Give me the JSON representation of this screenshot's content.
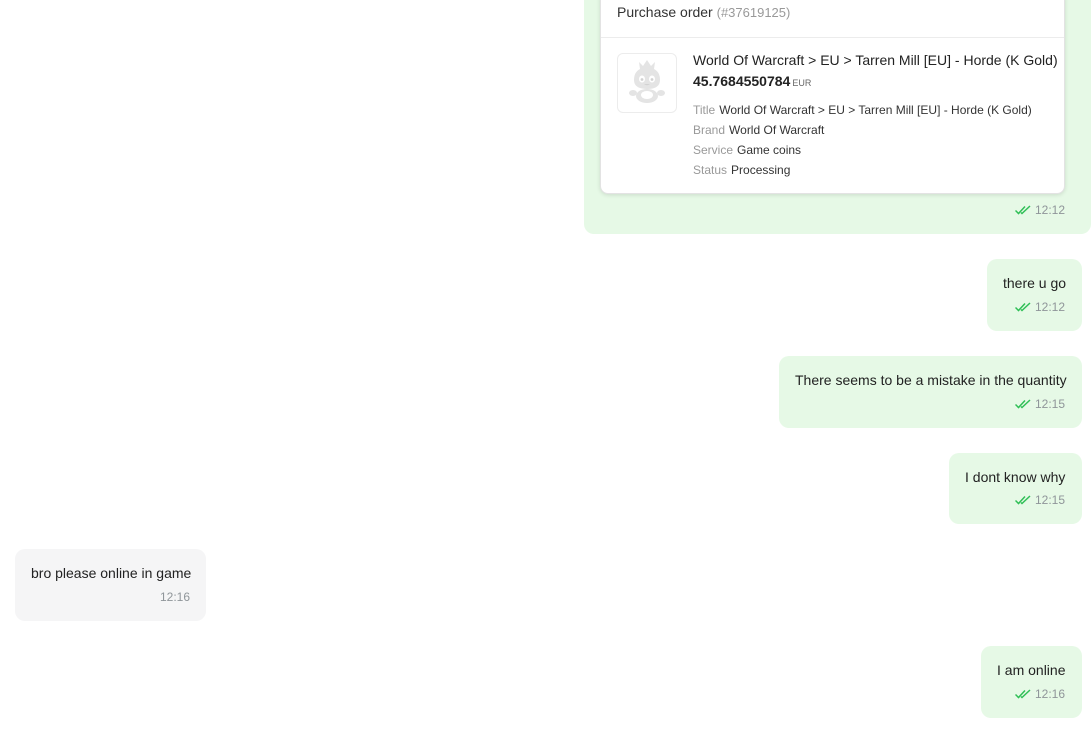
{
  "order_message": {
    "header_label": "Purchase order",
    "order_id": "(#37619125)",
    "product": {
      "title": "World Of Warcraft > EU > Tarren Mill [EU] - Horde (K Gold)",
      "price": "45.7684550784",
      "currency": "EUR",
      "thumbnail_icon": "mascot-placeholder-icon"
    },
    "details": [
      {
        "label": "Title",
        "value": "World Of Warcraft > EU > Tarren Mill [EU] - Horde (K Gold)"
      },
      {
        "label": "Brand",
        "value": "World Of Warcraft"
      },
      {
        "label": "Service",
        "value": "Game coins"
      },
      {
        "label": "Status",
        "value": "Processing"
      }
    ],
    "time": "12:12"
  },
  "messages": [
    {
      "direction": "outgoing",
      "text": "there u go",
      "time": "12:12",
      "read_icon": "double-check-icon"
    },
    {
      "direction": "outgoing",
      "text": "There seems to be a mistake in the quantity",
      "time": "12:15",
      "read_icon": "double-check-icon"
    },
    {
      "direction": "outgoing",
      "text": "I dont know why",
      "time": "12:15",
      "read_icon": "double-check-icon"
    },
    {
      "direction": "incoming",
      "text": "bro please online in game",
      "time": "12:16"
    },
    {
      "direction": "outgoing",
      "text": "I am online",
      "time": "12:16",
      "read_icon": "double-check-icon"
    }
  ],
  "colors": {
    "outgoing_bubble": "#e6f9e6",
    "incoming_bubble": "#f5f5f6",
    "read_check": "#2fbf56",
    "meta_text": "#8f9599"
  }
}
